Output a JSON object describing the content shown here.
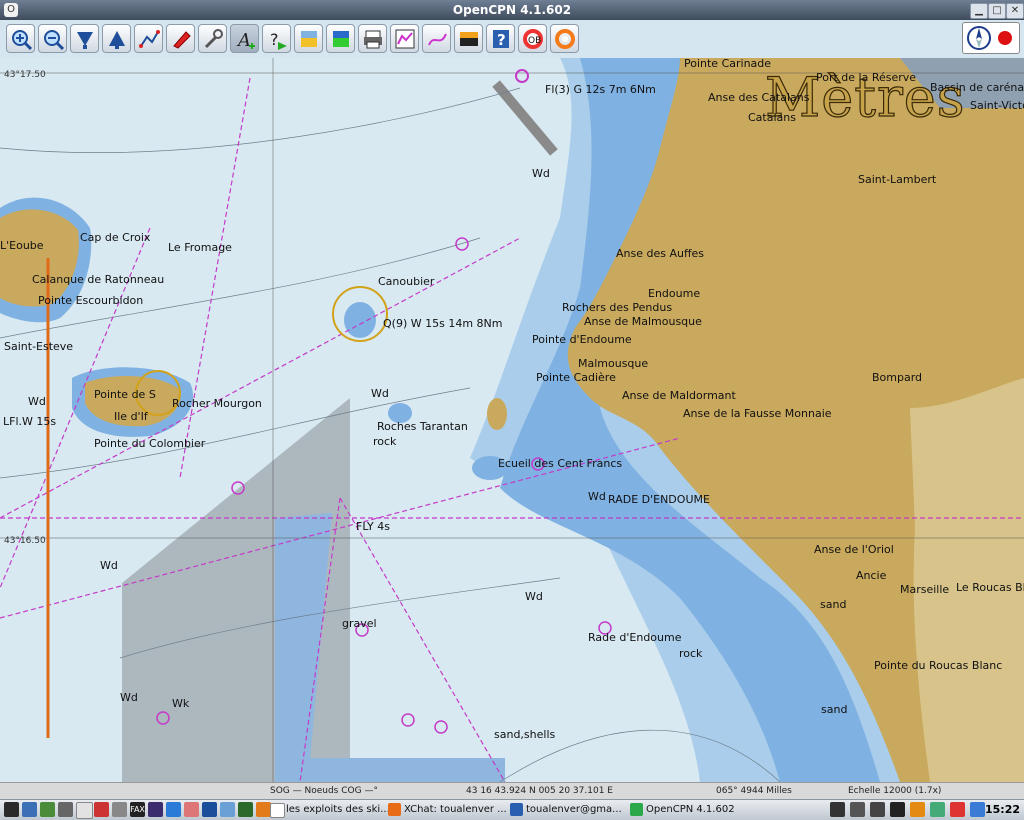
{
  "window": {
    "title": "OpenCPN 4.1.602"
  },
  "toolbar": {
    "buttons": [
      {
        "name": "zoom-in-button",
        "icon": "zoom-in-icon"
      },
      {
        "name": "zoom-out-button",
        "icon": "zoom-out-icon"
      },
      {
        "name": "scale-in-button",
        "icon": "scale-in-icon"
      },
      {
        "name": "scale-out-button",
        "icon": "scale-out-icon"
      },
      {
        "name": "route-button",
        "icon": "route-icon"
      },
      {
        "name": "auto-follow-button",
        "icon": "boat-icon"
      },
      {
        "name": "settings-button",
        "icon": "wrench-icon"
      },
      {
        "name": "text-button",
        "icon": "text-icon",
        "active": true
      },
      {
        "name": "current-button",
        "icon": "current-icon"
      },
      {
        "name": "tide-button",
        "icon": "tide-icon"
      },
      {
        "name": "chart-quilt-button",
        "icon": "chart-quilt-icon"
      },
      {
        "name": "print-button",
        "icon": "print-icon"
      },
      {
        "name": "route-manager-button",
        "icon": "route-manager-icon"
      },
      {
        "name": "track-button",
        "icon": "track-icon"
      },
      {
        "name": "color-scheme-button",
        "icon": "color-scheme-icon"
      },
      {
        "name": "help-button",
        "icon": "help-icon"
      },
      {
        "name": "mob-button",
        "icon": "man-overboard-icon"
      },
      {
        "name": "lifebuoy-button",
        "icon": "lifebuoy-icon"
      }
    ]
  },
  "chart": {
    "watermark": "Mètres",
    "lat_labels": [
      "43°17.50",
      "43°16.50"
    ],
    "place_labels": [
      "Port de la Réserve",
      "Pointe Carinade",
      "Anse des Catalans",
      "Catalans",
      "Bassin de carénage",
      "Saint-Victor",
      "Saint-Lambert",
      "Anse des Auffes",
      "Endoume",
      "Rochers des Pendus",
      "Anse de Malmousque",
      "Pointe d'Endoume",
      "Malmousque",
      "Pointe Cadière",
      "Anse de Maldormant",
      "Anse de la Fausse Monnaie",
      "Bompard",
      "Ecueil des Cent Francs",
      "RADE D'ENDOUME",
      "Anse de l'Oriol",
      "Ancie",
      "Marseille",
      "Le Roucas Bl",
      "Pointe du Roucas Blanc",
      "Cap de Croix",
      "Le Fromage",
      "L'Eoube",
      "Calanque de Ratonneau",
      "Pointe Escourbidon",
      "Saint-Esteve",
      "Pointe de S",
      "Rocher Mourgon",
      "Ile d'If",
      "Pointe du Colombier",
      "Canoubier",
      "Roches Tarantan",
      "Rade d'Endoume",
      "Fl(3) G 12s 7m 6Nm",
      "Q(9) W 15s 14m 8Nm",
      "FLY 4s",
      "LFl.W 15s"
    ],
    "seabed_labels": [
      "Wd",
      "Wd",
      "Wd",
      "Wd",
      "Wd",
      "Wd",
      "Wd",
      "gravel",
      "rock",
      "rock",
      "sand",
      "sand",
      "sand,shells",
      "Wk"
    ]
  },
  "status": {
    "sog": "SOG — Noeuds COG —°",
    "position": "43 16 43.924 N   005 20 37.101 E",
    "bearing": "065°  4944 Milles",
    "scale": "Echelle 12000 (1.7x)"
  },
  "taskbar": {
    "tasks": [
      {
        "label": "les exploits des ski...",
        "color": "#ffffff"
      },
      {
        "label": "XChat: toualenver ...",
        "color": "#e86b18"
      },
      {
        "label": "toualenver@gma...",
        "color": "#2a5fb0"
      },
      {
        "label": "OpenCPN 4.1.602",
        "color": "#2aa84a"
      }
    ],
    "clock": "15:22"
  }
}
